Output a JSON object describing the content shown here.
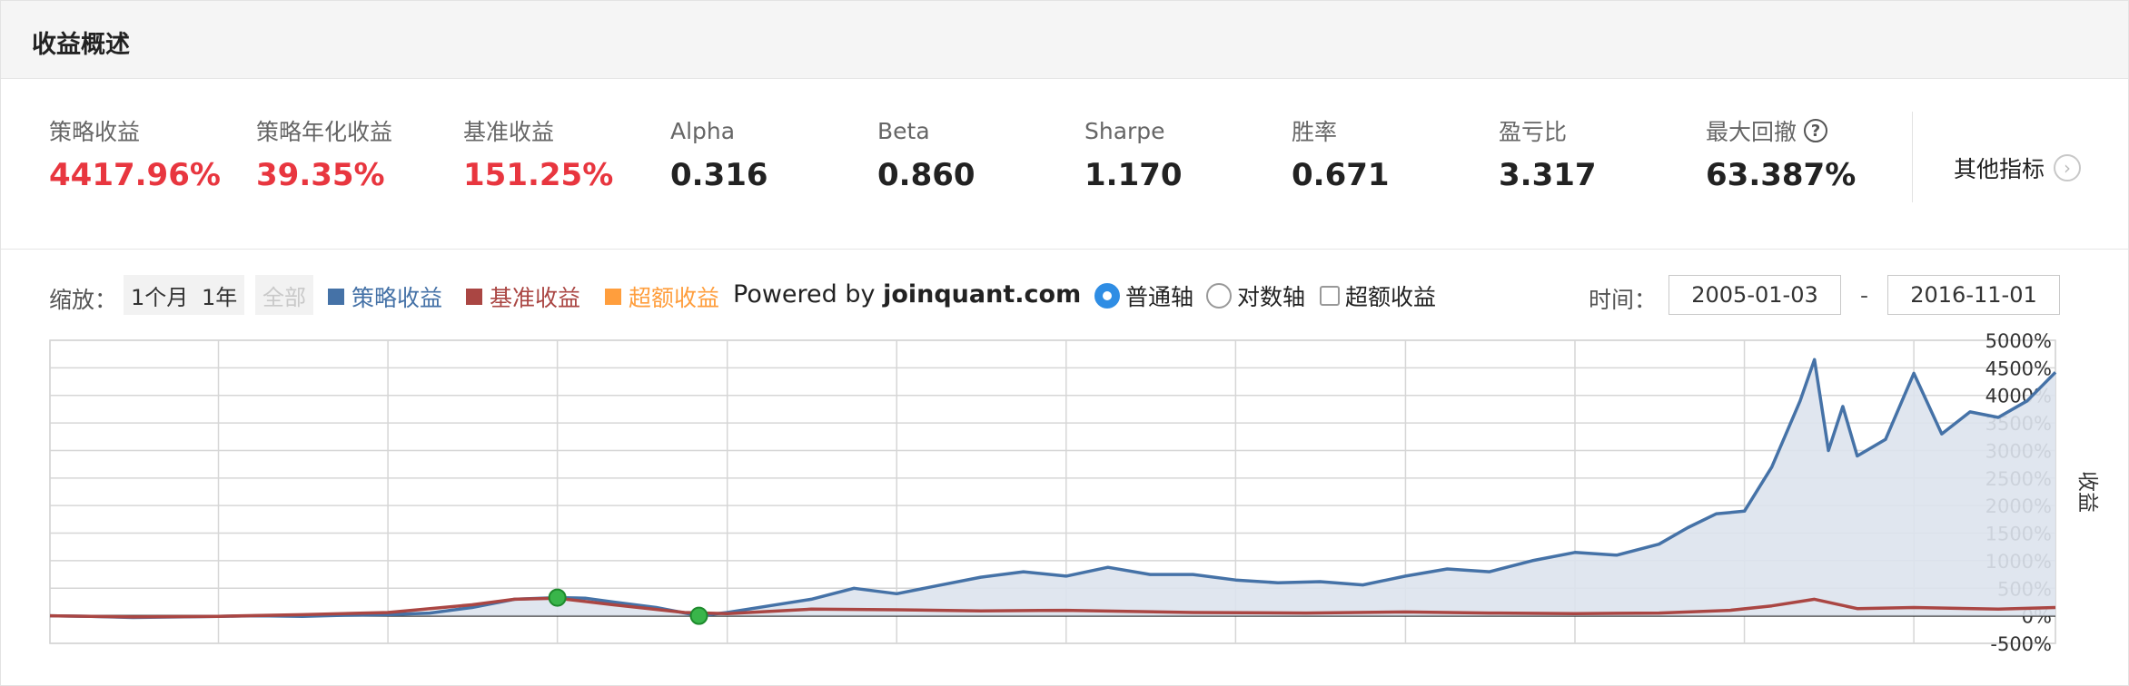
{
  "header": {
    "title": "收益概述"
  },
  "metrics": [
    {
      "label": "策略收益",
      "value": "4417.96%",
      "positive": true
    },
    {
      "label": "策略年化收益",
      "value": "39.35%",
      "positive": true
    },
    {
      "label": "基准收益",
      "value": "151.25%",
      "positive": true
    },
    {
      "label": "Alpha",
      "value": "0.316",
      "positive": false
    },
    {
      "label": "Beta",
      "value": "0.860",
      "positive": false
    },
    {
      "label": "Sharpe",
      "value": "1.170",
      "positive": false
    },
    {
      "label": "胜率",
      "value": "0.671",
      "positive": false
    },
    {
      "label": "盈亏比",
      "value": "3.317",
      "positive": false
    },
    {
      "label": "最大回撤",
      "value": "63.387%",
      "positive": false,
      "help": true
    }
  ],
  "other_metrics_label": "其他指标",
  "help_glyph": "?",
  "chevron_glyph": "›",
  "toolbar": {
    "zoom_label": "缩放：",
    "zoom_buttons": [
      {
        "label": "1个月",
        "enabled": true
      },
      {
        "label": "1年",
        "enabled": true
      },
      {
        "label": "全部",
        "enabled": false
      }
    ],
    "legend": [
      {
        "label": "策略收益",
        "color": "#4572a7"
      },
      {
        "label": "基准收益",
        "color": "#aa4643"
      },
      {
        "label": "超额收益",
        "color": "#ff9e3d"
      }
    ],
    "powered_prefix": "Powered by ",
    "powered_site": "joinquant.com",
    "axis_options": [
      {
        "label": "普通轴",
        "type": "radio",
        "checked": true
      },
      {
        "label": "对数轴",
        "type": "radio",
        "checked": false
      },
      {
        "label": "超额收益",
        "type": "checkbox",
        "checked": false
      }
    ],
    "time_label": "时间：",
    "date_from": "2005-01-03",
    "date_sep": "-",
    "date_to": "2016-11-01"
  },
  "colors": {
    "strategy": "#4572a7",
    "benchmark": "#aa4643",
    "excess": "#ff9e3d",
    "positive": "#e8363f",
    "radio_checked": "#2f8de4",
    "area_fill": "#dde3ed",
    "marker": "#39b54a"
  },
  "chart_data": {
    "type": "line",
    "x_range": [
      "2005-01-03",
      "2016-11-01"
    ],
    "ylabel": "收益",
    "yticks": [
      "5000%",
      "4500%",
      "4000%",
      "3500%",
      "3000%",
      "2500%",
      "2000%",
      "1500%",
      "1000%",
      "500%",
      "0%",
      "-500%"
    ],
    "ylim": [
      -500,
      5000
    ],
    "y_axis_position": "right",
    "grid": true,
    "series": [
      {
        "name": "策略收益",
        "color": "#4572a7",
        "area": true,
        "points": [
          [
            "2005-01-03",
            0
          ],
          [
            "2005-04-01",
            -10
          ],
          [
            "2005-07-01",
            -30
          ],
          [
            "2005-10-01",
            -20
          ],
          [
            "2006-01-01",
            -10
          ],
          [
            "2006-04-01",
            0
          ],
          [
            "2006-07-01",
            -10
          ],
          [
            "2006-10-01",
            10
          ],
          [
            "2007-01-01",
            20
          ],
          [
            "2007-04-01",
            50
          ],
          [
            "2007-07-01",
            150
          ],
          [
            "2007-10-01",
            300
          ],
          [
            "2008-01-01",
            330
          ],
          [
            "2008-03-01",
            320
          ],
          [
            "2008-05-01",
            250
          ],
          [
            "2008-08-01",
            150
          ],
          [
            "2008-11-01",
            0
          ],
          [
            "2009-01-01",
            60
          ],
          [
            "2009-04-01",
            180
          ],
          [
            "2009-07-01",
            300
          ],
          [
            "2009-10-01",
            500
          ],
          [
            "2010-01-01",
            400
          ],
          [
            "2010-04-01",
            550
          ],
          [
            "2010-07-01",
            700
          ],
          [
            "2010-10-01",
            800
          ],
          [
            "2011-01-01",
            720
          ],
          [
            "2011-04-01",
            880
          ],
          [
            "2011-07-01",
            750
          ],
          [
            "2011-10-01",
            750
          ],
          [
            "2012-01-01",
            650
          ],
          [
            "2012-04-01",
            600
          ],
          [
            "2012-07-01",
            620
          ],
          [
            "2012-10-01",
            560
          ],
          [
            "2013-01-01",
            720
          ],
          [
            "2013-04-01",
            850
          ],
          [
            "2013-07-01",
            800
          ],
          [
            "2013-10-01",
            1000
          ],
          [
            "2014-01-01",
            1150
          ],
          [
            "2014-04-01",
            1100
          ],
          [
            "2014-07-01",
            1300
          ],
          [
            "2014-09-01",
            1600
          ],
          [
            "2014-11-01",
            1850
          ],
          [
            "2015-01-01",
            1900
          ],
          [
            "2015-03-01",
            2700
          ],
          [
            "2015-05-01",
            3900
          ],
          [
            "2015-06-01",
            4650
          ],
          [
            "2015-07-01",
            3000
          ],
          [
            "2015-08-01",
            3800
          ],
          [
            "2015-09-01",
            2900
          ],
          [
            "2015-11-01",
            3200
          ],
          [
            "2016-01-01",
            4400
          ],
          [
            "2016-03-01",
            3300
          ],
          [
            "2016-05-01",
            3700
          ],
          [
            "2016-07-01",
            3600
          ],
          [
            "2016-09-01",
            3900
          ],
          [
            "2016-11-01",
            4418
          ]
        ]
      },
      {
        "name": "基准收益",
        "color": "#aa4643",
        "area": false,
        "points": [
          [
            "2005-01-03",
            0
          ],
          [
            "2005-07-01",
            -20
          ],
          [
            "2006-01-01",
            -10
          ],
          [
            "2006-07-01",
            20
          ],
          [
            "2007-01-01",
            60
          ],
          [
            "2007-07-01",
            200
          ],
          [
            "2007-10-01",
            300
          ],
          [
            "2008-01-01",
            320
          ],
          [
            "2008-05-01",
            200
          ],
          [
            "2008-10-01",
            60
          ],
          [
            "2009-01-01",
            40
          ],
          [
            "2009-07-01",
            120
          ],
          [
            "2010-01-01",
            110
          ],
          [
            "2010-07-01",
            90
          ],
          [
            "2011-01-01",
            100
          ],
          [
            "2011-10-01",
            60
          ],
          [
            "2012-06-01",
            50
          ],
          [
            "2013-01-01",
            70
          ],
          [
            "2013-07-01",
            50
          ],
          [
            "2014-01-01",
            40
          ],
          [
            "2014-07-01",
            50
          ],
          [
            "2014-12-01",
            100
          ],
          [
            "2015-03-01",
            180
          ],
          [
            "2015-06-01",
            300
          ],
          [
            "2015-09-01",
            130
          ],
          [
            "2016-01-01",
            151
          ],
          [
            "2016-07-01",
            120
          ],
          [
            "2016-11-01",
            151
          ]
        ]
      }
    ],
    "markers": [
      {
        "date": "2008-01-01",
        "value": 330
      },
      {
        "date": "2008-11-01",
        "value": 0
      }
    ]
  }
}
